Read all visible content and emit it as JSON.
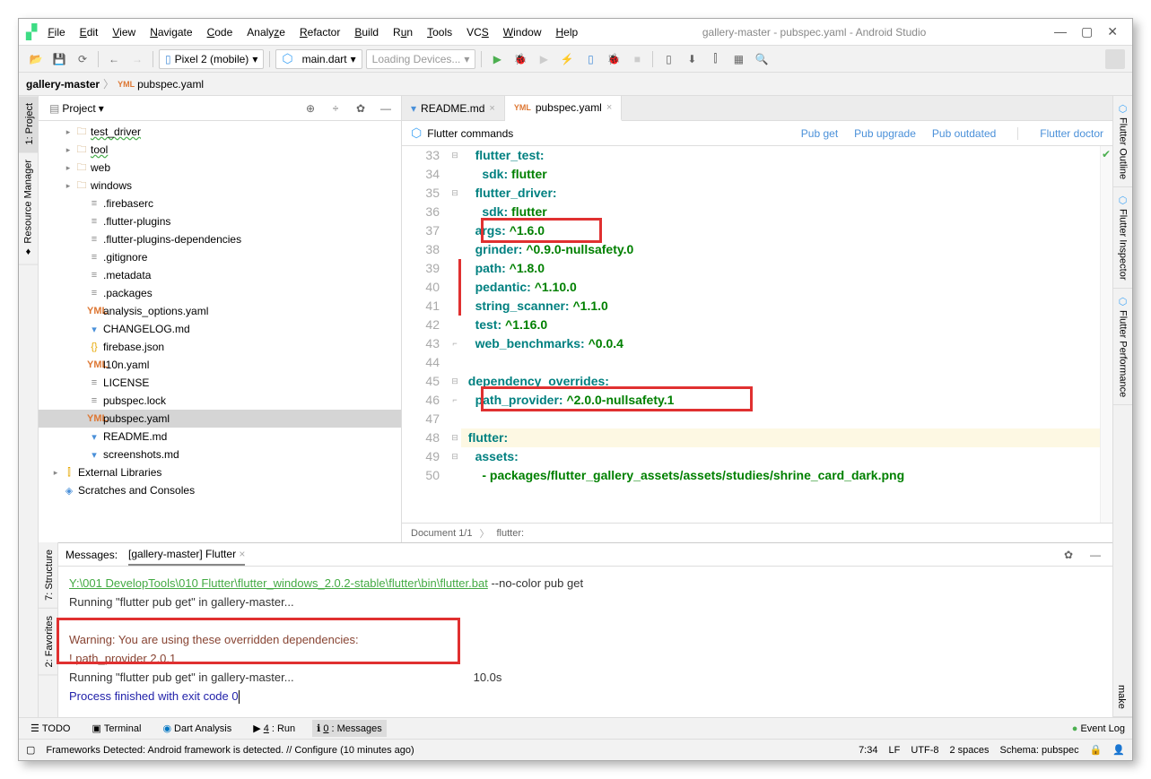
{
  "window": {
    "title": "gallery-master - pubspec.yaml - Android Studio"
  },
  "menu": [
    "File",
    "Edit",
    "View",
    "Navigate",
    "Code",
    "Analyze",
    "Refactor",
    "Build",
    "Run",
    "Tools",
    "VCS",
    "Window",
    "Help"
  ],
  "toolbar": {
    "device": "Pixel 2 (mobile)",
    "config": "main.dart",
    "devices": "Loading Devices..."
  },
  "breadcrumb": {
    "root": "gallery-master",
    "file": "pubspec.yaml"
  },
  "project": {
    "title": "Project",
    "tree": [
      {
        "label": "test_driver",
        "type": "folder",
        "indent": 2,
        "arrow": "▸",
        "wave": true
      },
      {
        "label": "tool",
        "type": "folder",
        "indent": 2,
        "arrow": "▸",
        "wave": true
      },
      {
        "label": "web",
        "type": "folder",
        "indent": 2,
        "arrow": "▸"
      },
      {
        "label": "windows",
        "type": "folder",
        "indent": 2,
        "arrow": "▸"
      },
      {
        "label": ".firebaserc",
        "type": "file",
        "indent": 3
      },
      {
        "label": ".flutter-plugins",
        "type": "file",
        "indent": 3
      },
      {
        "label": ".flutter-plugins-dependencies",
        "type": "file",
        "indent": 3
      },
      {
        "label": ".gitignore",
        "type": "file",
        "indent": 3
      },
      {
        "label": ".metadata",
        "type": "file",
        "indent": 3
      },
      {
        "label": ".packages",
        "type": "file",
        "indent": 3
      },
      {
        "label": "analysis_options.yaml",
        "type": "yaml",
        "indent": 3
      },
      {
        "label": "CHANGELOG.md",
        "type": "md",
        "indent": 3
      },
      {
        "label": "firebase.json",
        "type": "json",
        "indent": 3
      },
      {
        "label": "l10n.yaml",
        "type": "yaml",
        "indent": 3
      },
      {
        "label": "LICENSE",
        "type": "file",
        "indent": 3
      },
      {
        "label": "pubspec.lock",
        "type": "file",
        "indent": 3
      },
      {
        "label": "pubspec.yaml",
        "type": "yaml",
        "indent": 3,
        "selected": true
      },
      {
        "label": "README.md",
        "type": "md",
        "indent": 3
      },
      {
        "label": "screenshots.md",
        "type": "md",
        "indent": 3
      },
      {
        "label": "External Libraries",
        "type": "lib",
        "indent": 1,
        "arrow": "▸"
      },
      {
        "label": "Scratches and Consoles",
        "type": "scratch",
        "indent": 1,
        "arrow": ""
      }
    ]
  },
  "editorTabs": [
    {
      "label": "README.md",
      "icon": "md"
    },
    {
      "label": "pubspec.yaml",
      "icon": "yml",
      "active": true
    }
  ],
  "flutterCommands": {
    "label": "Flutter commands",
    "links": [
      "Pub get",
      "Pub upgrade",
      "Pub outdated",
      "Flutter doctor"
    ]
  },
  "code": {
    "lines": [
      {
        "n": 33,
        "indent": "    ",
        "key": "flutter_test",
        "val": ""
      },
      {
        "n": 34,
        "indent": "      ",
        "key": "sdk",
        "val": "flutter"
      },
      {
        "n": 35,
        "indent": "    ",
        "key": "flutter_driver",
        "val": ""
      },
      {
        "n": 36,
        "indent": "      ",
        "key": "sdk",
        "val": "flutter"
      },
      {
        "n": 37,
        "indent": "    ",
        "key": "args",
        "val": "^1.6.0",
        "box": 1
      },
      {
        "n": 38,
        "indent": "    ",
        "key": "grinder",
        "val": "^0.9.0-nullsafety.0"
      },
      {
        "n": 39,
        "indent": "    ",
        "key": "path",
        "val": "^1.8.0"
      },
      {
        "n": 40,
        "indent": "    ",
        "key": "pedantic",
        "val": "^1.10.0"
      },
      {
        "n": 41,
        "indent": "    ",
        "key": "string_scanner",
        "val": "^1.1.0"
      },
      {
        "n": 42,
        "indent": "    ",
        "key": "test",
        "val": "^1.16.0"
      },
      {
        "n": 43,
        "indent": "    ",
        "key": "web_benchmarks",
        "val": "^0.0.4"
      },
      {
        "n": 44,
        "indent": "",
        "key": "",
        "val": ""
      },
      {
        "n": 45,
        "indent": "  ",
        "key": "dependency_overrides",
        "val": ""
      },
      {
        "n": 46,
        "indent": "    ",
        "key": "path_provider",
        "val": "^2.0.0-nullsafety.1",
        "box": 2
      },
      {
        "n": 47,
        "indent": "",
        "key": "",
        "val": ""
      },
      {
        "n": 48,
        "indent": "  ",
        "key": "flutter",
        "val": "",
        "hl": true
      },
      {
        "n": 49,
        "indent": "    ",
        "key": "assets",
        "val": ""
      },
      {
        "n": 50,
        "indent": "      ",
        "key": "",
        "val": "- packages/flutter_gallery_assets/assets/studies/shrine_card_dark.png",
        "list": true
      }
    ]
  },
  "editorBreadcrumb": {
    "doc": "Document 1/1",
    "key": "flutter:"
  },
  "messages": {
    "tabLabel": "Messages:",
    "subTab": "[gallery-master] Flutter",
    "link": "Y:\\001 DevelopTools\\010 Flutter\\flutter_windows_2.0.2-stable\\flutter\\bin\\flutter.bat",
    "linkArgs": " --no-color pub get",
    "line2": "Running \"flutter pub get\" in gallery-master...",
    "warn1": "Warning: You are using these overridden dependencies:",
    "warn2": "! path_provider 2.0.1",
    "line3a": "Running \"flutter pub get\" in gallery-master...",
    "line3b": "10.0s",
    "exit": "Process finished with exit code 0"
  },
  "bottomTabs": {
    "todo": "TODO",
    "terminal": "Terminal",
    "dart": "Dart Analysis",
    "run": "4: Run",
    "messages": "0: Messages",
    "eventLog": "Event Log"
  },
  "statusBar": {
    "msg": "Frameworks Detected: Android framework is detected. // Configure (10 minutes ago)",
    "pos": "7:34",
    "enc": "LF",
    "charset": "UTF-8",
    "indent": "2 spaces",
    "schema": "Schema: pubspec"
  },
  "leftGutter": [
    "1: Project",
    "Resource Manager"
  ],
  "leftGutterBottom": [
    "7: Structure",
    "2: Favorites"
  ],
  "rightGutter": [
    "Flutter Outline",
    "Flutter Inspector",
    "Flutter Performance",
    "make"
  ]
}
